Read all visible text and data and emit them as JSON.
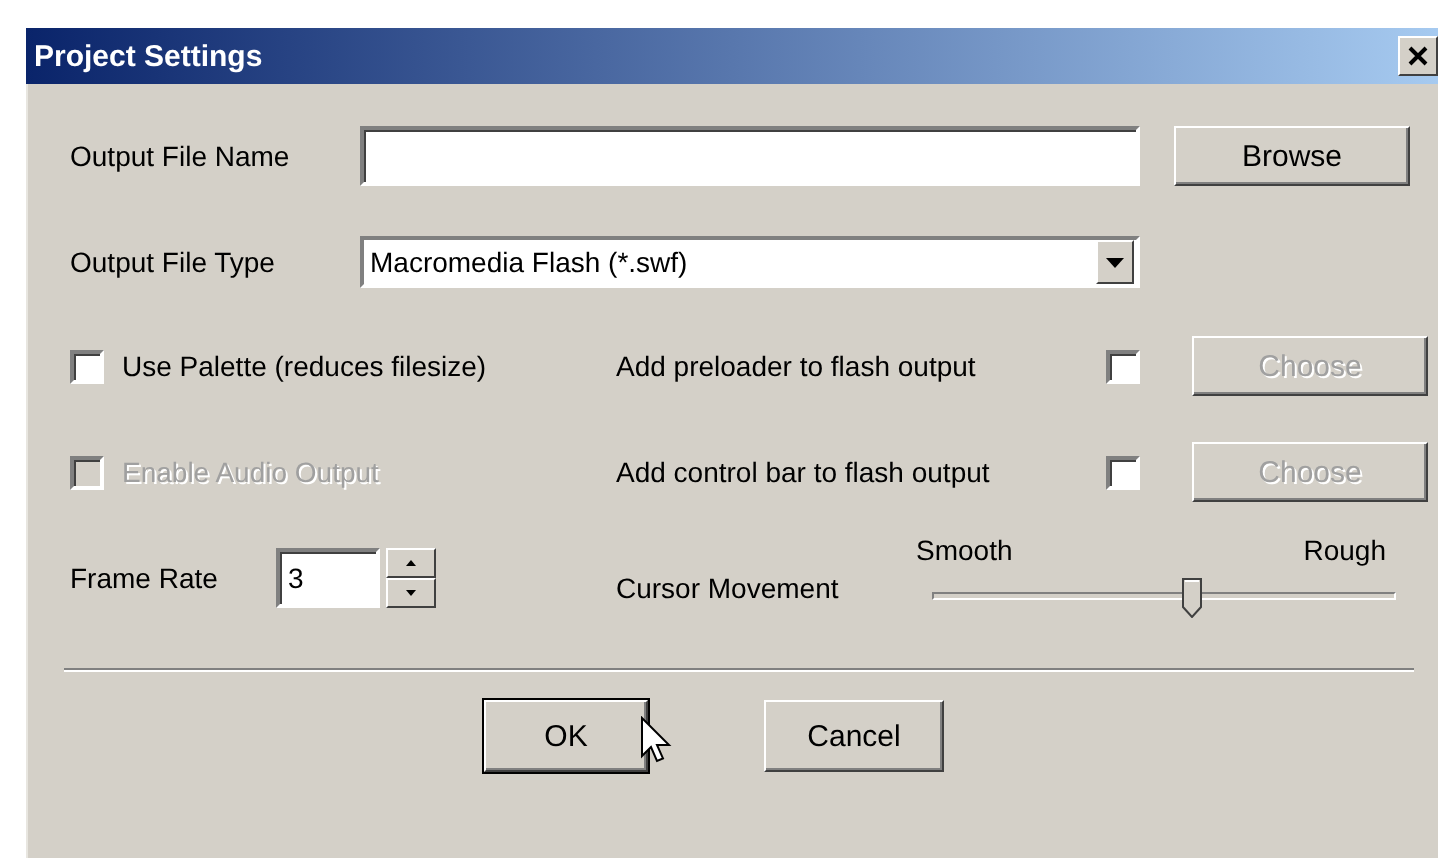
{
  "window": {
    "title": "Project Settings"
  },
  "output_file_name": {
    "label": "Output File Name",
    "button": "Browse"
  },
  "output_file_type": {
    "label": "Output File Type",
    "value": "Macromedia Flash (*.swf)"
  },
  "options": [
    {
      "label": "Use Palette (reduces filesize)",
      "checked": false,
      "disabled": false
    },
    {
      "label": "Enable Audio Output",
      "checked": false,
      "disabled": true
    }
  ],
  "flash_options": [
    {
      "label": "Add preloader to flash output",
      "checked": false,
      "button": "Choose",
      "button_disabled": true
    },
    {
      "label": "Add control bar to flash output",
      "checked": false,
      "button": "Choose",
      "button_disabled": true
    }
  ],
  "frame_rate": {
    "label": "Frame Rate",
    "value": "3"
  },
  "cursor_movement": {
    "label": "Cursor Movement",
    "min_label": "Smooth",
    "max_label": "Rough",
    "level": 0.56
  },
  "buttons": [
    {
      "label": "OK",
      "default": true
    },
    {
      "label": "Cancel",
      "default": false
    }
  ]
}
